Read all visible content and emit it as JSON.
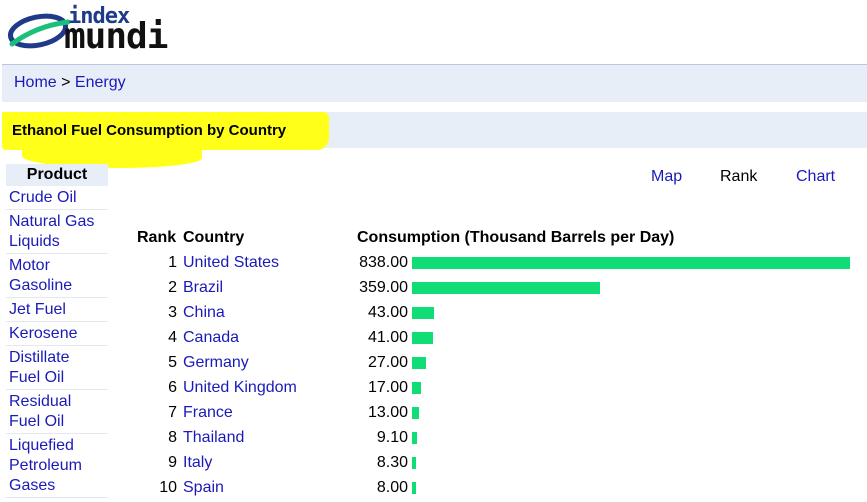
{
  "logo": {
    "line1": "index",
    "line2": "mundi"
  },
  "breadcrumb": {
    "home": "Home",
    "separator": " > ",
    "section": "Energy"
  },
  "page_title": "Ethanol Fuel Consumption by Country",
  "sidebar": {
    "header": "Product",
    "items": [
      "Crude Oil",
      "Natural Gas Liquids",
      "Motor Gasoline",
      "Jet Fuel",
      "Kerosene",
      "Distillate Fuel Oil",
      "Residual Fuel Oil",
      "Liquefied Petroleum Gases"
    ]
  },
  "view_tabs": {
    "map": "Map",
    "rank": "Rank",
    "chart": "Chart"
  },
  "table": {
    "headers": {
      "rank": "Rank",
      "country": "Country",
      "consumption": "Consumption (Thousand Barrels per Day)"
    },
    "bar_color": "#11dd77",
    "max_value": 838.0,
    "rows": [
      {
        "rank": "1",
        "country": "United States",
        "value": "838.00",
        "num": 838.0
      },
      {
        "rank": "2",
        "country": "Brazil",
        "value": "359.00",
        "num": 359.0
      },
      {
        "rank": "3",
        "country": "China",
        "value": "43.00",
        "num": 43.0
      },
      {
        "rank": "4",
        "country": "Canada",
        "value": "41.00",
        "num": 41.0
      },
      {
        "rank": "5",
        "country": "Germany",
        "value": "27.00",
        "num": 27.0
      },
      {
        "rank": "6",
        "country": "United Kingdom",
        "value": "17.00",
        "num": 17.0
      },
      {
        "rank": "7",
        "country": "France",
        "value": "13.00",
        "num": 13.0
      },
      {
        "rank": "8",
        "country": "Thailand",
        "value": "9.10",
        "num": 9.1
      },
      {
        "rank": "9",
        "country": "Italy",
        "value": "8.30",
        "num": 8.3
      },
      {
        "rank": "10",
        "country": "Spain",
        "value": "8.00",
        "num": 8.0
      }
    ]
  }
}
